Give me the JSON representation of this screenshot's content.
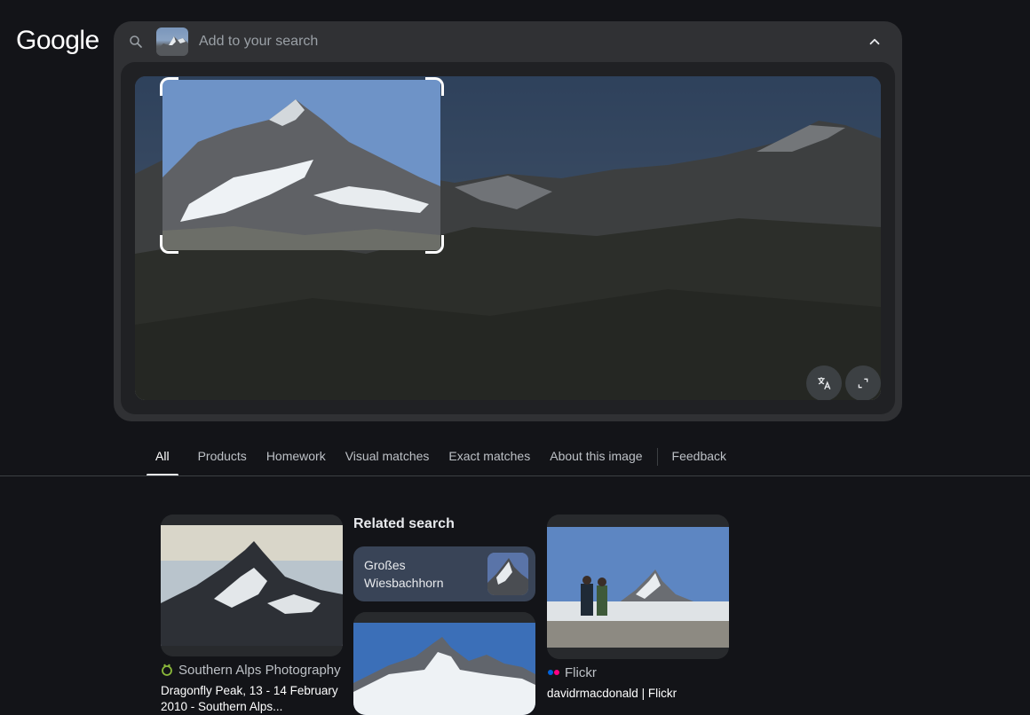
{
  "logo": "Google",
  "search": {
    "placeholder": "Add to your search"
  },
  "tabs": [
    {
      "label": "All",
      "active": true
    },
    {
      "label": "Products"
    },
    {
      "label": "Homework"
    },
    {
      "label": "Visual matches"
    },
    {
      "label": "Exact matches"
    },
    {
      "label": "About this image"
    },
    {
      "label": "Feedback"
    }
  ],
  "results": {
    "card1": {
      "source": "Southern Alps Photography",
      "title": "Dragonfly Peak, 13 - 14 February 2010 - Southern Alps..."
    },
    "related": {
      "heading": "Related search",
      "chip_label": "Großes Wiesbachhorn"
    },
    "card3": {
      "source": "Flickr",
      "title": "davidrmacdonald | Flickr"
    }
  },
  "colors": {
    "background": "#131418",
    "panel": "#303134",
    "chip": "#394457",
    "source_icon_green": "#8ab83a",
    "flickr_blue": "#0063dc",
    "flickr_pink": "#ff0084"
  },
  "icons": [
    "search-icon",
    "chevron-up-icon",
    "translate-icon",
    "expand-icon",
    "site-favicon",
    "flickr-icon"
  ]
}
